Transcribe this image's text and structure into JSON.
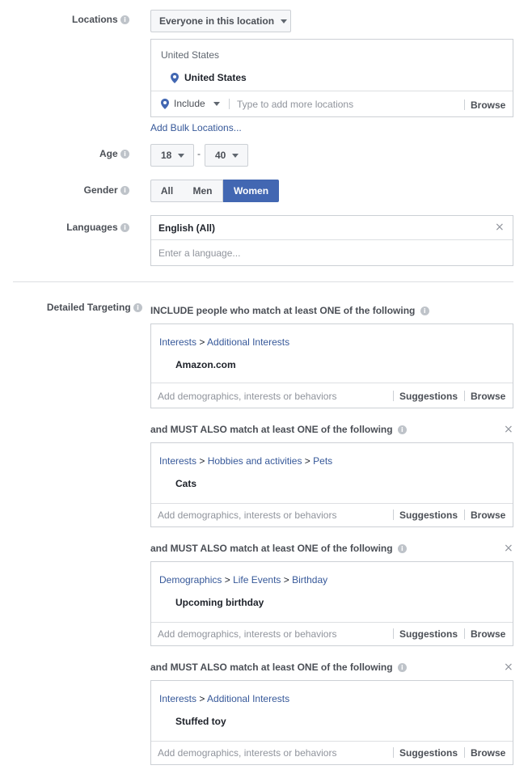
{
  "locations": {
    "label": "Locations",
    "scope_dropdown": "Everyone in this location",
    "country_header": "United States",
    "selected": "United States",
    "include_dropdown": "Include",
    "placeholder": "Type to add more locations",
    "browse": "Browse",
    "bulk_link": "Add Bulk Locations..."
  },
  "age": {
    "label": "Age",
    "min": "18",
    "dash": "-",
    "max": "40"
  },
  "gender": {
    "label": "Gender",
    "options": [
      "All",
      "Men",
      "Women"
    ],
    "selected": "Women"
  },
  "languages": {
    "label": "Languages",
    "selected": "English (All)",
    "placeholder": "Enter a language..."
  },
  "detailed_targeting": {
    "label": "Detailed Targeting",
    "include_heading": "INCLUDE people who match at least ONE of the following",
    "must_heading": "and MUST ALSO match at least ONE of the following",
    "input_placeholder": "Add demographics, interests or behaviors",
    "suggestions": "Suggestions",
    "browse": "Browse",
    "groups": [
      {
        "crumbs": [
          "Interests",
          "Additional Interests"
        ],
        "item": "Amazon.com"
      },
      {
        "crumbs": [
          "Interests",
          "Hobbies and activities",
          "Pets"
        ],
        "item": "Cats"
      },
      {
        "crumbs": [
          "Demographics",
          "Life Events",
          "Birthday"
        ],
        "item": "Upcoming birthday"
      },
      {
        "crumbs": [
          "Interests",
          "Additional Interests"
        ],
        "item": "Stuffed toy"
      }
    ]
  },
  "colors": {
    "accent": "#4267b2",
    "link": "#365899",
    "border": "#ccd0d5"
  }
}
